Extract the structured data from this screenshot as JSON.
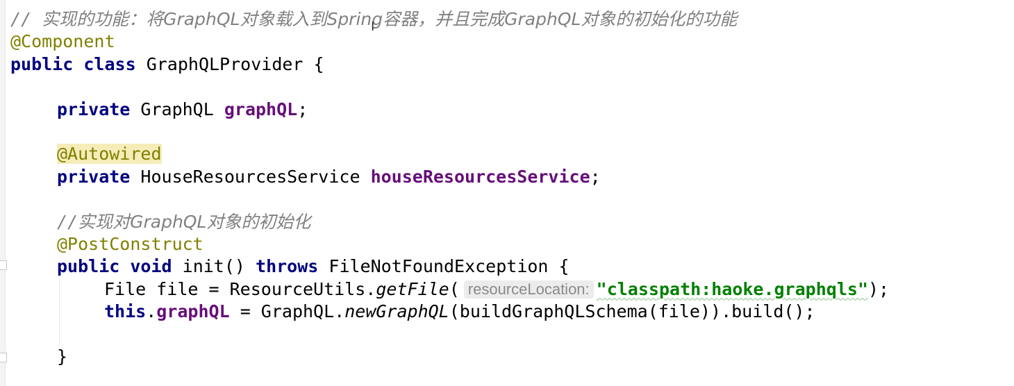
{
  "editor": {
    "lines": {
      "l1_comment_prefix": "// ",
      "l1_comment_text": "实现的功能：将GraphQL对象载入到Spring容器，并且完成GraphQL对象的初始化的功能",
      "l2_annotation": "@Component",
      "l3_kw_public": "public",
      "l3_kw_class": "class",
      "l3_class_name": "GraphQLProvider {",
      "l5_kw_private": "private",
      "l5_type": "GraphQL",
      "l5_field": "graphQL",
      "l5_semicolon": ";",
      "l7_annotation": "@Autowired",
      "l8_kw_private": "private",
      "l8_type": "HouseResourcesService",
      "l8_field": "houseResourcesService",
      "l8_semicolon": ";",
      "l10_comment_prefix": "//",
      "l10_comment_text": "实现对GraphQL对象的初始化",
      "l11_annotation": "@PostConstruct",
      "l12_kw_public": "public",
      "l12_kw_void": "void",
      "l12_method": "init()",
      "l12_kw_throws": "throws",
      "l12_exception": "FileNotFoundException {",
      "l13_decl": "File file = ResourceUtils.",
      "l13_method": "getFile",
      "l13_paren_open": "(",
      "l13_param_hint": "resourceLocation:",
      "l13_string": "\"classpath:haoke.graphqls\"",
      "l13_end": ");",
      "l14_kw_this": "this",
      "l14_dot": ".",
      "l14_field": "graphQL",
      "l14_assign": " = GraphQL.",
      "l14_static_method": "newGraphQL",
      "l14_rest": "(buildGraphQLSchema(file)).build();",
      "l16_close_brace": "}"
    }
  },
  "colors": {
    "keyword": "#000080",
    "annotation": "#808000",
    "field": "#660e7a",
    "comment": "#808080",
    "string": "#008000",
    "hint_bg": "#ececec"
  },
  "icons": {
    "cursor": "i-beam-cursor"
  }
}
